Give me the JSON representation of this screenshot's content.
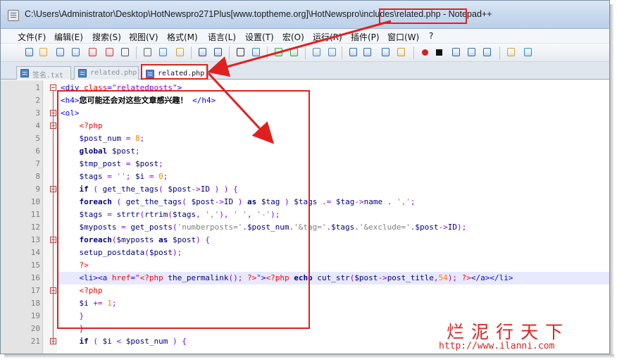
{
  "window": {
    "title": "C:\\Users\\Administrator\\Desktop\\HotNewspro271Plus[www.toptheme.org]\\HotNewspro\\includes\\related.php - Notepad++"
  },
  "menu": [
    "文件(F)",
    "编辑(E)",
    "搜索(S)",
    "视图(V)",
    "格式(M)",
    "语言(L)",
    "设置(T)",
    "宏(O)",
    "运行(R)",
    "插件(P)",
    "窗口(W)",
    "?"
  ],
  "tabs": [
    {
      "label": "签名.txt",
      "active": false
    },
    {
      "label": "related.php",
      "active": false
    },
    {
      "label": "related.php",
      "active": true
    }
  ],
  "toolbar_icons": [
    "new-file-icon",
    "open-file-icon",
    "save-icon",
    "save-all-icon",
    "close-icon",
    "close-all-icon",
    "print-icon",
    "cut-icon",
    "copy-icon",
    "paste-icon",
    "undo-icon",
    "redo-icon",
    "find-icon",
    "replace-icon",
    "zoom-in-icon",
    "zoom-out-icon",
    "sync-v-icon",
    "sync-h-icon",
    "word-wrap-icon",
    "show-all-chars-icon",
    "indent-guide-icon",
    "user-lang-icon",
    "macro-record-icon",
    "macro-stop-icon",
    "macro-play-icon",
    "macro-run-multiple-icon",
    "macro-save-icon",
    "spell-check-icon",
    "launch-browser-icon"
  ],
  "line_numbers": [
    "1",
    "2",
    "3",
    "4",
    "5",
    "6",
    "7",
    "8",
    "9",
    "10",
    "11",
    "12",
    "13",
    "14",
    "15",
    "16",
    "17",
    "18",
    "19",
    "20",
    "21"
  ],
  "code_lines": [
    [
      [
        "tg",
        "<div "
      ],
      [
        "at",
        "class"
      ],
      [
        "tg",
        "="
      ],
      [
        "av",
        "\"relatedposts\""
      ],
      [
        "tg",
        ">"
      ]
    ],
    [
      [
        "tg",
        "<h4>"
      ],
      [
        "tx",
        "您可能还会对这些文章感兴趣！"
      ],
      [
        "tg",
        " </h4>"
      ]
    ],
    [
      [
        "tg",
        "<ol>"
      ]
    ],
    [
      [
        "sp",
        "    "
      ],
      [
        "ph",
        "<?php"
      ]
    ],
    [
      [
        "sp",
        "    "
      ],
      [
        "vr",
        "$post_num"
      ],
      [
        "op",
        " = "
      ],
      [
        "nm",
        "8"
      ],
      [
        "op",
        ";"
      ]
    ],
    [
      [
        "sp",
        "    "
      ],
      [
        "kw",
        "global"
      ],
      [
        "vr",
        " $post"
      ],
      [
        "op",
        ";"
      ]
    ],
    [
      [
        "sp",
        "    "
      ],
      [
        "vr",
        "$tmp_post"
      ],
      [
        "op",
        " = "
      ],
      [
        "vr",
        "$post"
      ],
      [
        "op",
        ";"
      ]
    ],
    [
      [
        "sp",
        "    "
      ],
      [
        "vr",
        "$tags"
      ],
      [
        "op",
        " = "
      ],
      [
        "st",
        "''"
      ],
      [
        "op",
        "; "
      ],
      [
        "vr",
        "$i"
      ],
      [
        "op",
        " = "
      ],
      [
        "nm",
        "0"
      ],
      [
        "op",
        ";"
      ]
    ],
    [
      [
        "sp",
        "    "
      ],
      [
        "kw",
        "if"
      ],
      [
        "op",
        " ( "
      ],
      [
        "df",
        "get_the_tags"
      ],
      [
        "op",
        "( "
      ],
      [
        "vr",
        "$post"
      ],
      [
        "op",
        "->"
      ],
      [
        "df",
        "ID"
      ],
      [
        "op",
        " ) ) {"
      ]
    ],
    [
      [
        "sp",
        "    "
      ],
      [
        "kw",
        "foreach"
      ],
      [
        "op",
        " ( "
      ],
      [
        "df",
        "get_the_tags"
      ],
      [
        "op",
        "( "
      ],
      [
        "vr",
        "$post"
      ],
      [
        "op",
        "->"
      ],
      [
        "df",
        "ID"
      ],
      [
        "op",
        " ) "
      ],
      [
        "kw",
        "as"
      ],
      [
        "vr",
        " $tag"
      ],
      [
        "op",
        " ) "
      ],
      [
        "vr",
        "$tags"
      ],
      [
        "op",
        " .= "
      ],
      [
        "vr",
        "$tag"
      ],
      [
        "op",
        "->"
      ],
      [
        "df",
        "name"
      ],
      [
        "op",
        " . "
      ],
      [
        "st",
        "','"
      ],
      [
        "op",
        ";"
      ]
    ],
    [
      [
        "sp",
        "    "
      ],
      [
        "vr",
        "$tags"
      ],
      [
        "op",
        " = "
      ],
      [
        "df",
        "strtr"
      ],
      [
        "op",
        "("
      ],
      [
        "df",
        "rtrim"
      ],
      [
        "op",
        "("
      ],
      [
        "vr",
        "$tags"
      ],
      [
        "op",
        ", "
      ],
      [
        "st",
        "','"
      ],
      [
        "op",
        "), "
      ],
      [
        "st",
        "' '"
      ],
      [
        "op",
        ", "
      ],
      [
        "st",
        "'-'"
      ],
      [
        "op",
        ");"
      ]
    ],
    [
      [
        "sp",
        "    "
      ],
      [
        "vr",
        "$myposts"
      ],
      [
        "op",
        " = "
      ],
      [
        "df",
        "get_posts"
      ],
      [
        "op",
        "("
      ],
      [
        "st",
        "'numberposts='"
      ],
      [
        "op",
        "."
      ],
      [
        "vr",
        "$post_num"
      ],
      [
        "op",
        "."
      ],
      [
        "st",
        "'&tag='"
      ],
      [
        "op",
        "."
      ],
      [
        "vr",
        "$tags"
      ],
      [
        "op",
        "."
      ],
      [
        "st",
        "'&exclude='"
      ],
      [
        "op",
        "."
      ],
      [
        "vr",
        "$post"
      ],
      [
        "op",
        "->"
      ],
      [
        "df",
        "ID"
      ],
      [
        "op",
        ");"
      ]
    ],
    [
      [
        "sp",
        "    "
      ],
      [
        "kw",
        "foreach"
      ],
      [
        "op",
        "("
      ],
      [
        "vr",
        "$myposts"
      ],
      [
        "kw",
        " as"
      ],
      [
        "vr",
        " $post"
      ],
      [
        "op",
        ") {"
      ]
    ],
    [
      [
        "sp",
        "    "
      ],
      [
        "df",
        "setup_postdata"
      ],
      [
        "op",
        "("
      ],
      [
        "vr",
        "$post"
      ],
      [
        "op",
        ");"
      ]
    ],
    [
      [
        "sp",
        "    "
      ],
      [
        "ph",
        "?>"
      ]
    ],
    [
      [
        "sp",
        "    "
      ],
      [
        "tg",
        "<li><a "
      ],
      [
        "at",
        "href"
      ],
      [
        "tg",
        "="
      ],
      [
        "av",
        "\""
      ],
      [
        "ph",
        "<?php"
      ],
      [
        "df",
        " the_permalink"
      ],
      [
        "op",
        "(); "
      ],
      [
        "ph",
        "?>"
      ],
      [
        "av",
        "\""
      ],
      [
        "tg",
        ">"
      ],
      [
        "ph",
        "<?php"
      ],
      [
        "kw",
        " echo"
      ],
      [
        "df",
        " cut_str"
      ],
      [
        "op",
        "("
      ],
      [
        "vr",
        "$post"
      ],
      [
        "op",
        "->"
      ],
      [
        "df",
        "post_title"
      ],
      [
        "op",
        ","
      ],
      [
        "nm",
        "54"
      ],
      [
        "op",
        "); "
      ],
      [
        "ph",
        "?>"
      ],
      [
        "tg",
        "</a></li>"
      ]
    ],
    [
      [
        "sp",
        "    "
      ],
      [
        "ph",
        "<?php"
      ]
    ],
    [
      [
        "sp",
        "    "
      ],
      [
        "vr",
        "$i"
      ],
      [
        "op",
        " += "
      ],
      [
        "nm",
        "1"
      ],
      [
        "op",
        ";"
      ]
    ],
    [
      [
        "sp",
        "    "
      ],
      [
        "op",
        "}"
      ]
    ],
    [
      [
        "sp",
        "    "
      ],
      [
        "op",
        "}"
      ]
    ],
    [
      [
        "sp",
        "    "
      ],
      [
        "kw",
        "if"
      ],
      [
        "op",
        " ( "
      ],
      [
        "vr",
        "$i"
      ],
      [
        "op",
        " < "
      ],
      [
        "vr",
        "$post_num"
      ],
      [
        "op",
        " ) {"
      ]
    ]
  ],
  "watermark": {
    "text": "烂泥行天下",
    "url": "http://www.ilanni.com"
  },
  "colors": {
    "annotation_red": "#e02020",
    "current_line": "#e8e8ff"
  }
}
